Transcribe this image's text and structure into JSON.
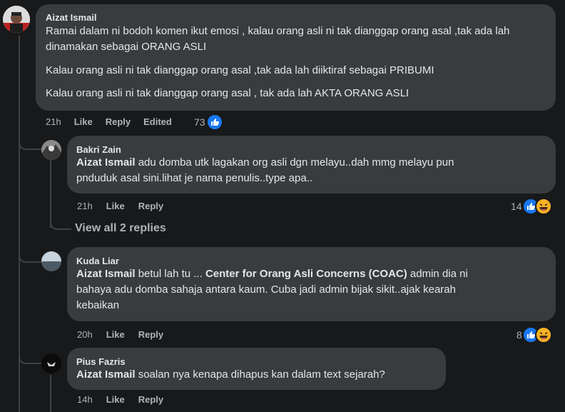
{
  "comments": [
    {
      "author": "Aizat Ismail",
      "paragraphs": [
        "Ramai dalam ni bodoh komen ikut emosi , kalau orang asli ni tak dianggap orang asal ,tak ada lah dinamakan sebagai ORANG ASLI",
        "Kalau orang asli ni tak dianggap orang asal ,tak ada lah diiktiraf sebagai PRIBUMI",
        "Kalau orang asli ni tak dianggap orang asal , tak ada lah AKTA ORANG ASLI"
      ],
      "time": "21h",
      "like": "Like",
      "reply": "Reply",
      "edited": "Edited",
      "reactions": "73",
      "reaction_icons": [
        "like-icon"
      ]
    }
  ],
  "replies": [
    {
      "author": "Bakri Zain",
      "mention": "Aizat Ismail",
      "text_line1": " adu domba utk lagakan org asli dgn melayu..dah mmg melayu pun",
      "text_line2": "pnduduk asal sini.lihat je nama penulis..type apa..",
      "time": "21h",
      "like": "Like",
      "reply": "Reply",
      "reactions": "14",
      "reaction_icons": [
        "like-icon",
        "haha-icon"
      ]
    },
    {
      "author": "Kuda Liar",
      "mention": "Aizat Ismail",
      "text_a": " betul lah tu ... ",
      "mention2": "Center for Orang Asli Concerns (COAC)",
      "text_b": " admin dia ni",
      "text_line2": "bahaya adu domba sahaja antara kaum. Cuba jadi admin bijak sikit..ajak kearah",
      "text_line3": "kebaikan",
      "time": "20h",
      "like": "Like",
      "reply": "Reply",
      "reactions": "8",
      "reaction_icons": [
        "like-icon",
        "haha-icon"
      ]
    },
    {
      "author": "Pius Fazris",
      "mention": "Aizat Ismail",
      "text": " soalan nya kenapa dihapus kan dalam text sejarah?",
      "time": "14h",
      "like": "Like",
      "reply": "Reply"
    }
  ],
  "view_all": "View all 2 replies",
  "colors": {
    "bg": "#18191a",
    "bubble": "#3a3b3c",
    "like_blue": "#1877f2",
    "haha_yellow": "#f7b125"
  }
}
